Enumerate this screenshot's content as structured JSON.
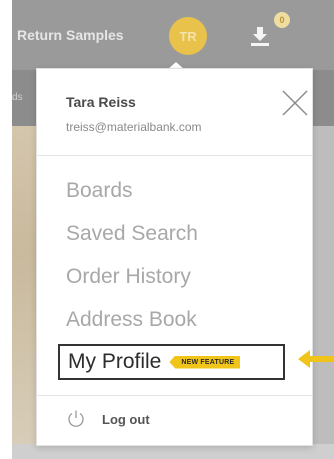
{
  "topbar": {
    "return_samples_label": "Return Samples",
    "avatar_initials": "TR",
    "download_badge": "0",
    "underbar_text": "ds"
  },
  "user": {
    "name": "Tara Reiss",
    "email": "treiss@materialbank.com"
  },
  "menu": {
    "items": [
      {
        "label": "Boards"
      },
      {
        "label": "Saved Search"
      },
      {
        "label": "Order History"
      },
      {
        "label": "Address Book"
      }
    ],
    "profile_label": "My Profile",
    "new_feature_badge": "NEW FEATURE",
    "logout_label": "Log out"
  },
  "colors": {
    "badge_yellow": "#f0c419",
    "avatar_yellow": "#e8c24a",
    "menu_text": "#a8a8a8",
    "overlay_gray": "#9a9a9a"
  },
  "icons": {
    "close": "close-icon",
    "download": "download-icon",
    "power": "power-icon",
    "arrow": "arrow-left-icon"
  }
}
